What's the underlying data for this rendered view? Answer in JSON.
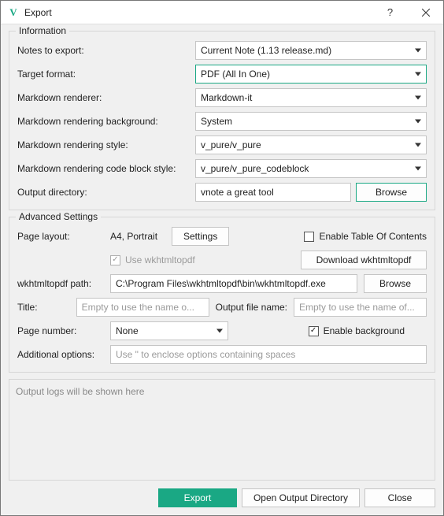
{
  "titlebar": {
    "title": "Export"
  },
  "info": {
    "legend": "Information",
    "notes_label": "Notes to export:",
    "notes_value": "Current Note (1.13 release.md)",
    "format_label": "Target format:",
    "format_value": "PDF (All In One)",
    "renderer_label": "Markdown renderer:",
    "renderer_value": "Markdown-it",
    "bg_label": "Markdown rendering background:",
    "bg_value": "System",
    "style_label": "Markdown rendering style:",
    "style_value": "v_pure/v_pure",
    "cbstyle_label": "Markdown rendering code block style:",
    "cbstyle_value": "v_pure/v_pure_codeblock",
    "outdir_label": "Output directory:",
    "outdir_value": "vnote a great tool",
    "browse": "Browse"
  },
  "adv": {
    "legend": "Advanced Settings",
    "page_layout_label": "Page layout:",
    "page_layout_value": "A4, Portrait",
    "settings_btn": "Settings",
    "enable_toc": "Enable Table Of Contents",
    "use_wk": "Use wkhtmltopdf",
    "download_wk": "Download wkhtmltopdf",
    "wk_path_label": "wkhtmltopdf path:",
    "wk_path_value": "C:\\Program Files\\wkhtmltopdf\\bin\\wkhtmltopdf.exe",
    "browse": "Browse",
    "title_label": "Title:",
    "title_placeholder": "Empty to use the name o...",
    "outfile_label": "Output file name:",
    "outfile_placeholder": "Empty to use the name of...",
    "pagenum_label": "Page number:",
    "pagenum_value": "None",
    "enable_bg": "Enable background",
    "addl_label": "Additional options:",
    "addl_placeholder": "Use \" to enclose options containing spaces"
  },
  "logs_placeholder": "Output logs will be shown here",
  "footer": {
    "export": "Export",
    "open_dir": "Open Output Directory",
    "close": "Close"
  }
}
